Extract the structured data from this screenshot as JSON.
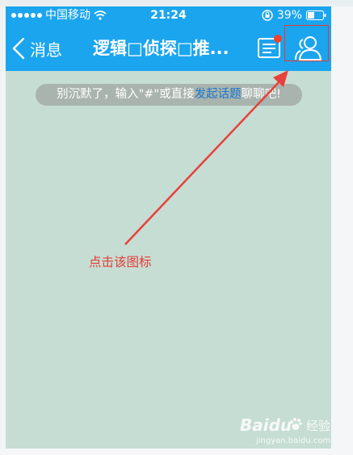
{
  "status_bar": {
    "carrier": "中国移动",
    "time": "21:24",
    "battery": "39%"
  },
  "nav": {
    "back_label": "消息",
    "title": "逻辑□侦探□推..."
  },
  "chat": {
    "hint_prefix": "别沉默了，输入\"#\"或直接",
    "hint_link": "发起话题",
    "hint_suffix": "聊聊吧!"
  },
  "annotation": {
    "text": "点击该图标"
  },
  "watermark": {
    "logo": "Baidu",
    "brand": "经验",
    "url": "jingyan.baidu.com"
  },
  "colors": {
    "nav_bg": "#1ba5ee",
    "chat_bg": "#c6ddd4",
    "annotation": "#e43c36",
    "link": "#1a76cc"
  },
  "icons": {
    "back": "chevron-left-icon",
    "list": "list-icon",
    "members": "group-members-icon",
    "wifi": "wifi-icon",
    "lock": "rotation-lock-icon",
    "battery": "battery-icon"
  }
}
